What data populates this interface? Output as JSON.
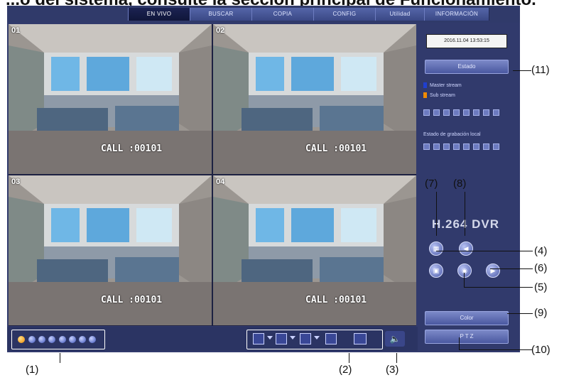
{
  "page_title_partial": "...o del sistema, consulte la sección principal de Funcionamiento.",
  "menu": {
    "tabs": [
      {
        "label": "EN VIVO",
        "active": true
      },
      {
        "label": "BUSCAR",
        "active": false
      },
      {
        "label": "COPIA",
        "active": false
      },
      {
        "label": "CONFIG",
        "active": false
      },
      {
        "label": "Utilidad",
        "active": false
      },
      {
        "label": "INFORMACIÓN",
        "active": false
      }
    ]
  },
  "cameras": [
    {
      "channel": "01",
      "overlay": "CALL :00101"
    },
    {
      "channel": "02",
      "overlay": "CALL :00101"
    },
    {
      "channel": "03",
      "overlay": "CALL :00101"
    },
    {
      "channel": "04",
      "overlay": "CALL :00101"
    }
  ],
  "right_panel": {
    "datetime": "2016.11.04 13:53:15",
    "status_button": "Estado",
    "legend": [
      {
        "label": "Master stream",
        "color": "#1f3fd0"
      },
      {
        "label": "Sub stream",
        "color": "#f08a00"
      }
    ],
    "recording_label": "Estado de grabación local",
    "brand": "H.264  DVR",
    "color_button": "Color",
    "ptz_button": "P T Z"
  },
  "annotations": {
    "a1": "(1)",
    "a2": "(2)",
    "a3": "(3)",
    "a4": "(4)",
    "a5": "(5)",
    "a6": "(6)",
    "a7": "(7)",
    "a8": "(8)",
    "a9": "(9)",
    "a10": "(10)",
    "a11": "(11)"
  },
  "colors": {
    "frame": "#313a6c",
    "accent_selected": "#f4a500",
    "active_channel": "#ee8a00"
  }
}
